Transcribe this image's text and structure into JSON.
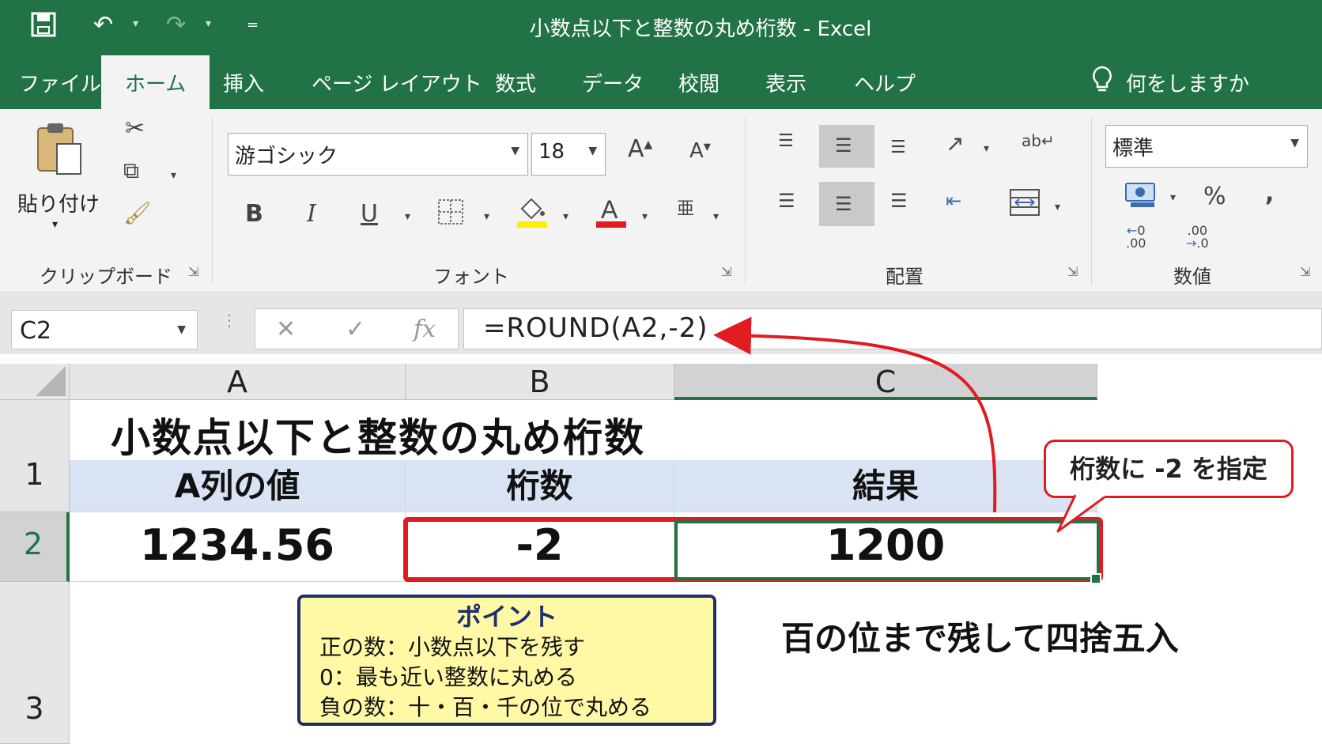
{
  "window": {
    "title": "小数点以下と整数の丸め桁数 - Excel",
    "accent_color": "#217346"
  },
  "tabs": [
    "ファイル",
    "ホーム",
    "挿入",
    "ページ レイアウト",
    "数式",
    "データ",
    "校閲",
    "表示",
    "ヘルプ"
  ],
  "active_tab": "ホーム",
  "tell_me": "何をしますか",
  "ribbon": {
    "clipboard": {
      "paste_label": "貼り付け",
      "group_label": "クリップボード"
    },
    "font": {
      "font_name": "游ゴシック",
      "font_size": "18",
      "group_label": "フォント",
      "fill_color": "#ffee00",
      "font_color": "#e11b22"
    },
    "alignment": {
      "group_label": "配置"
    },
    "number": {
      "format": "標準",
      "group_label": "数値",
      "percent": "%",
      "comma": "❜",
      "inc_decimal": ".00",
      "dec_decimal": ".0"
    }
  },
  "formula_bar": {
    "name_box": "C2",
    "fx": "fx",
    "formula": "=ROUND(A2,-2)"
  },
  "columns": [
    "A",
    "B",
    "C"
  ],
  "rows": [
    "1",
    "2",
    "3"
  ],
  "sheet": {
    "title": "小数点以下と整数の丸め桁数",
    "headers": [
      "A列の値",
      "桁数",
      "結果"
    ],
    "values": [
      "1234.56",
      "-2",
      "1200"
    ]
  },
  "callout": "桁数に -2 を指定",
  "point": {
    "title": "ポイント",
    "lines": [
      "正の数：小数点以下を残す",
      "0：最も近い整数に丸める",
      "負の数：十・百・千の位で丸める"
    ]
  },
  "note": "百の位まで残して四捨五入"
}
